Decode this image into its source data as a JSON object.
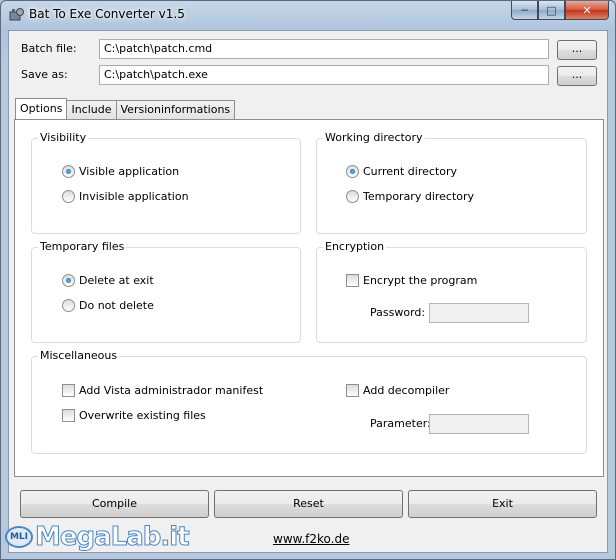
{
  "window": {
    "title": "Bat To Exe Converter v1.5"
  },
  "titlebar": {
    "minimize": "─",
    "maximize": "□",
    "close": "✕"
  },
  "files": {
    "batch_label": "Batch file:",
    "batch_value": "C:\\patch\\patch.cmd",
    "save_label": "Save as:",
    "save_value": "C:\\patch\\patch.exe",
    "browse_label": "..."
  },
  "tabs": [
    {
      "label": "Options",
      "active": true
    },
    {
      "label": "Include",
      "active": false
    },
    {
      "label": "Versioninformations",
      "active": false
    }
  ],
  "visibility": {
    "title": "Visibility",
    "options": [
      {
        "label": "Visible application",
        "checked": true
      },
      {
        "label": "Invisible application",
        "checked": false
      }
    ]
  },
  "working_directory": {
    "title": "Working directory",
    "options": [
      {
        "label": "Current directory",
        "checked": true
      },
      {
        "label": "Temporary directory",
        "checked": false
      }
    ]
  },
  "temporary_files": {
    "title": "Temporary files",
    "options": [
      {
        "label": "Delete at exit",
        "checked": true
      },
      {
        "label": "Do not delete",
        "checked": false
      }
    ]
  },
  "encryption": {
    "title": "Encryption",
    "encrypt_label": "Encrypt the program",
    "password_label": "Password:",
    "password_value": ""
  },
  "miscellaneous": {
    "title": "Miscellaneous",
    "vista_manifest_label": "Add Vista administrador manifest",
    "overwrite_label": "Overwrite existing files",
    "decompiler_label": "Add decompiler",
    "parameter_label": "Parameter:",
    "parameter_value": ""
  },
  "buttons": {
    "compile": "Compile",
    "reset": "Reset",
    "exit": "Exit"
  },
  "footer": {
    "link": "www.f2ko.de"
  },
  "watermark": {
    "logo": "MLI",
    "text": "MegaLab.it"
  }
}
